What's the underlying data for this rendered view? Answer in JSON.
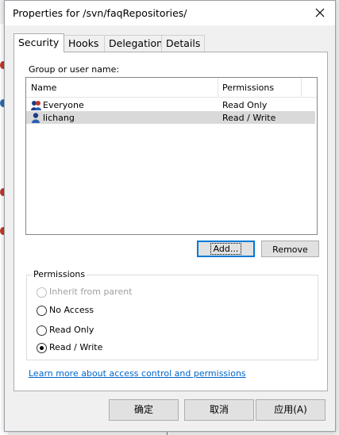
{
  "dialog": {
    "title": "Properties for /svn/faqRepositories/",
    "close_icon": "close-icon"
  },
  "tabs": [
    {
      "label": "Security",
      "active": true
    },
    {
      "label": "Hooks",
      "active": false
    },
    {
      "label": "Delegation",
      "active": false
    },
    {
      "label": "Details",
      "active": false
    }
  ],
  "security": {
    "group_label": "Group or user name:",
    "columns": {
      "name": "Name",
      "permissions": "Permissions"
    },
    "rows": [
      {
        "name": "Everyone",
        "permission": "Read Only",
        "icon": "group-icon",
        "selected": false
      },
      {
        "name": "lichang",
        "permission": "Read / Write",
        "icon": "user-icon",
        "selected": true
      }
    ],
    "add_button": "Add...",
    "remove_button": "Remove",
    "permissions_group": {
      "label": "Permissions",
      "options": [
        {
          "label": "Inherit from parent",
          "enabled": false,
          "checked": false
        },
        {
          "label": "No Access",
          "enabled": true,
          "checked": false
        },
        {
          "label": "Read Only",
          "enabled": true,
          "checked": false
        },
        {
          "label": "Read / Write",
          "enabled": true,
          "checked": true
        }
      ]
    },
    "learn_more_link": "Learn more about access control and permissions"
  },
  "buttons": {
    "ok": "确定",
    "cancel": "取消",
    "apply": "应用(A)"
  },
  "colors": {
    "accent": "#0078d7",
    "link": "#0066cc",
    "selection": "#d9d9d9"
  }
}
